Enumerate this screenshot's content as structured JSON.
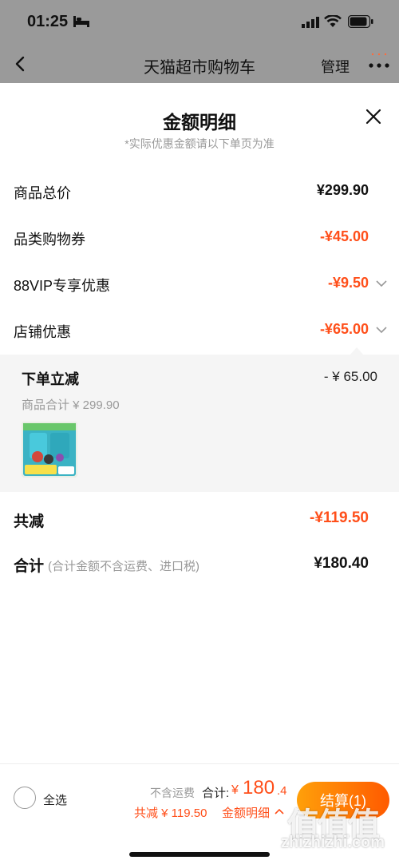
{
  "status_bar": {
    "time": "01:25"
  },
  "nav": {
    "title": "天猫超市购物车",
    "manage_label": "管理"
  },
  "sheet": {
    "title": "金额明细",
    "subtitle": "*实际优惠金额请以下单页为准",
    "rows": [
      {
        "label": "商品总价",
        "value": "¥299.90"
      },
      {
        "label": "品类购物券",
        "value": "-¥45.00"
      },
      {
        "label": "88VIP专享优惠",
        "value": "-¥9.50"
      },
      {
        "label": "店铺优惠",
        "value": "-¥65.00"
      }
    ],
    "detail": {
      "title": "下单立减",
      "value": "- ¥ 65.00",
      "subtotal": "商品合计 ¥ 299.90"
    },
    "total_reduce": {
      "label": "共减",
      "value": "-¥119.50"
    },
    "sum": {
      "label": "合计",
      "note": "(合计金额不含运费、进口税)",
      "value": "¥180.40"
    }
  },
  "bottom": {
    "select_all": "全选",
    "shipping_note": "不含运费",
    "subtotal_label": "合计:",
    "currency": "¥",
    "subtotal_value": "180",
    "subtotal_decimal": ".4",
    "reduce_text": "共减 ¥ 119.50",
    "detail_link": "金额明细",
    "checkout_label": "结算(1)"
  },
  "watermark": {
    "glyphs": "值值值",
    "text": "zhizhizhi.com"
  },
  "colors": {
    "accent_red": "#ff4f1a",
    "checkout_start": "#ffa00a",
    "checkout_end": "#ff5a00"
  }
}
